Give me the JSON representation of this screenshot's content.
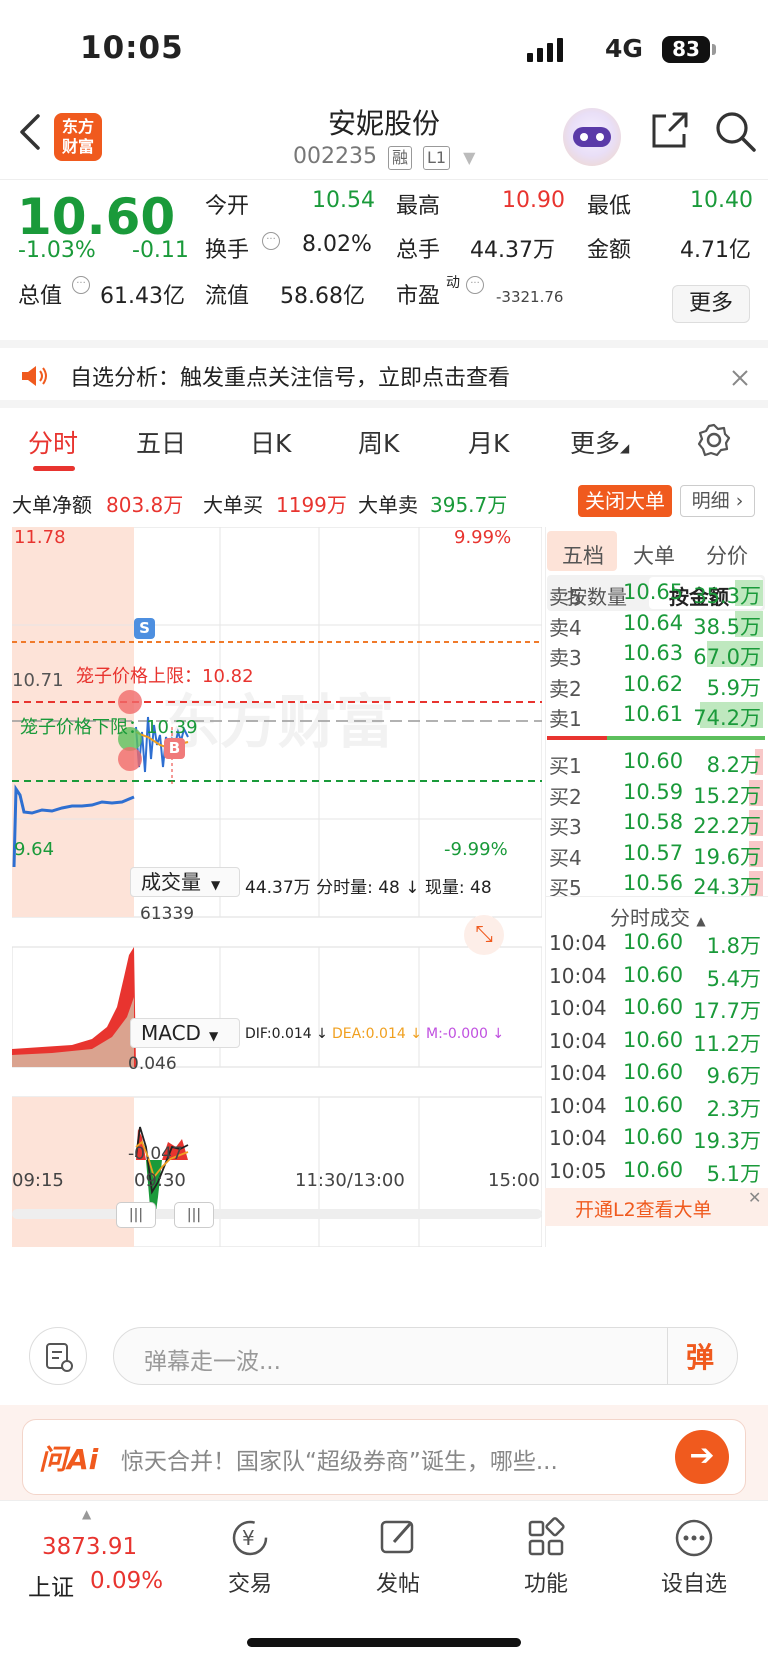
{
  "status": {
    "time": "10:05",
    "network": "4G",
    "battery": "83"
  },
  "header": {
    "logo_text": "东方财富",
    "stock_name": "安妮股份",
    "stock_code": "002235",
    "tags": [
      "融",
      "L1"
    ]
  },
  "quote": {
    "price": "10.60",
    "change_pct": "-1.03%",
    "change": "-0.11",
    "open_label": "今开",
    "open": "10.54",
    "high_label": "最高",
    "high": "10.90",
    "low_label": "最低",
    "low": "10.40",
    "turnover_label": "换手",
    "turnover": "8.02%",
    "volume_label": "总手",
    "volume": "44.37万",
    "amount_label": "金额",
    "amount": "4.71亿",
    "mktcap_label": "总值",
    "mktcap": "61.43亿",
    "float_label": "流值",
    "float": "58.68亿",
    "pe_label": "市盈",
    "pe_sup": "动",
    "pe": "-3321.76",
    "more": "更多"
  },
  "banner": {
    "text": "自选分析：触发重点关注信号，立即点击查看"
  },
  "tabs": [
    "分时",
    "五日",
    "日K",
    "周K",
    "月K",
    "更多"
  ],
  "bigorder": {
    "net_label": "大单净额",
    "net": "803.8万",
    "buy_label": "大单买",
    "buy": "1199万",
    "sell_label": "大单卖",
    "sell": "395.7万",
    "close_btn": "关闭大单",
    "detail_btn": "明细"
  },
  "chart": {
    "top_price": "11.78",
    "top_pct": "9.99%",
    "bottom_price": "9.64",
    "bottom_pct": "-9.99%",
    "prev_close": "10.71",
    "upper_limit": "笼子价格上限：10.82",
    "lower_limit": "笼子价格下限：10.39",
    "watermark": "东方财富",
    "s_marker": "S",
    "b_marker": "B",
    "vol_selector": "成交量",
    "vol_info": "44.37万 分时量: 48 ↓ 现量: 48",
    "vol_max": "61339",
    "macd_selector": "MACD",
    "dif": "DIF:0.014 ↓",
    "dea": "DEA:0.014 ↓",
    "m": "M:-0.000 ↓",
    "macd_top": "0.046",
    "macd_bottom": "-0.047",
    "times": [
      "09:15",
      "09:30",
      "11:30/13:00",
      "15:00"
    ]
  },
  "chart_data": {
    "type": "line",
    "title": "",
    "y_range": [
      9.64,
      11.78
    ],
    "prev_close": 10.71,
    "upper_limit": 10.82,
    "lower_limit": 10.39,
    "x_labels": [
      "09:15",
      "09:30",
      "11:30/13:00",
      "15:00"
    ]
  },
  "book": {
    "tabs": [
      "五档",
      "大单",
      "分价"
    ],
    "subtabs": [
      "按数量",
      "按金额"
    ],
    "sells": [
      {
        "label": "卖5",
        "price": "10.65",
        "vol": "35.3万",
        "bar": 0.2
      },
      {
        "label": "卖4",
        "price": "10.64",
        "vol": "38.5万",
        "bar": 0.2
      },
      {
        "label": "卖3",
        "price": "10.63",
        "vol": "67.0万",
        "bar": 0.4
      },
      {
        "label": "卖2",
        "price": "10.62",
        "vol": "5.9万",
        "bar": 0
      },
      {
        "label": "卖1",
        "price": "10.61",
        "vol": "74.2万",
        "bar": 0.45
      }
    ],
    "buys": [
      {
        "label": "买1",
        "price": "10.60",
        "vol": "8.2万",
        "bar": 0.06
      },
      {
        "label": "买2",
        "price": "10.59",
        "vol": "15.2万",
        "bar": 0.1
      },
      {
        "label": "买3",
        "price": "10.58",
        "vol": "22.2万",
        "bar": 0.1
      },
      {
        "label": "买4",
        "price": "10.57",
        "vol": "19.6万",
        "bar": 0.1
      },
      {
        "label": "买5",
        "price": "10.56",
        "vol": "24.3万",
        "bar": 0.1
      }
    ],
    "ticks_title": "分时成交",
    "ticks": [
      {
        "t": "10:04",
        "p": "10.60",
        "v": "1.8万"
      },
      {
        "t": "10:04",
        "p": "10.60",
        "v": "5.4万"
      },
      {
        "t": "10:04",
        "p": "10.60",
        "v": "17.7万"
      },
      {
        "t": "10:04",
        "p": "10.60",
        "v": "11.2万"
      },
      {
        "t": "10:04",
        "p": "10.60",
        "v": "9.6万"
      },
      {
        "t": "10:04",
        "p": "10.60",
        "v": "2.3万"
      },
      {
        "t": "10:04",
        "p": "10.60",
        "v": "19.3万"
      },
      {
        "t": "10:05",
        "p": "10.60",
        "v": "5.1万"
      }
    ],
    "l2_promo": "开通L2查看大单"
  },
  "chat": {
    "placeholder": "弹幕走一波...",
    "send": "弹"
  },
  "ai": {
    "logo": "问Ai",
    "text": "惊天合并！国家队“超级券商”诞生，哪些..."
  },
  "nav": {
    "index_value": "3873.91",
    "index_name": "上证",
    "index_pct": "0.09%",
    "items": [
      "交易",
      "发帖",
      "功能",
      "设自选"
    ]
  },
  "colors": {
    "up": "#e8342f",
    "down": "#1a9a3a",
    "accent": "#f05a1e"
  }
}
